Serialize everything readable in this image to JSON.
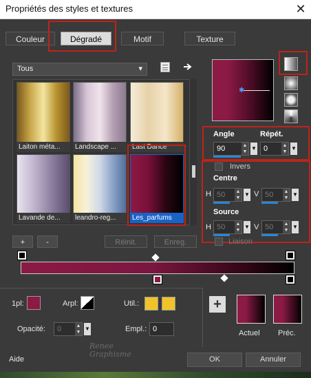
{
  "window": {
    "title": "Propriétés des styles et textures",
    "close_glyph": "✕"
  },
  "tabs": [
    {
      "label": "Couleur"
    },
    {
      "label": "Dégradé"
    },
    {
      "label": "Motif"
    },
    {
      "label": "Texture"
    }
  ],
  "category_select": {
    "value": "Tous",
    "arrow": "▾"
  },
  "gradients": [
    {
      "label": "Laiton méta..."
    },
    {
      "label": "Landscape ..."
    },
    {
      "label": "Last Dance"
    },
    {
      "label": "Lavande de..."
    },
    {
      "label": "leandro-reg..."
    },
    {
      "label": "Les_parfums"
    }
  ],
  "list_buttons": {
    "add": "+",
    "remove": "-",
    "reset": "Réinit.",
    "save": "Enreg."
  },
  "params": {
    "angle_label": "Angle",
    "angle_value": "90",
    "repeat_label": "Répét.",
    "repeat_value": "0",
    "invert_label": "Invers",
    "center_label": "Centre",
    "source_label": "Source",
    "h_label": "H",
    "v_label": "V",
    "center_h": "50",
    "center_v": "50",
    "source_h": "50",
    "source_v": "50",
    "link_label": "Liaison"
  },
  "bottom": {
    "opl_label": "1pl:",
    "arpl_label": "Arpl:",
    "util_label": "Util.:",
    "opacity_label": "Opacité:",
    "opacity_value": "0",
    "empl_label": "Empl.:",
    "empl_value": "0",
    "current_label": "Actuel",
    "previous_label": "Préc.",
    "add_glyph": "+"
  },
  "footer": {
    "help": "Aide",
    "ok": "OK",
    "cancel": "Annuler"
  },
  "watermark": {
    "line1": "Renee",
    "line2": "Graphisme"
  },
  "colors": {
    "gradient_start": "#8b1a45",
    "gradient_end": "#000000",
    "accent_blue": "#1a63c6",
    "highlight_red": "#c0231a",
    "swatch_yellow": "#f0c429"
  }
}
